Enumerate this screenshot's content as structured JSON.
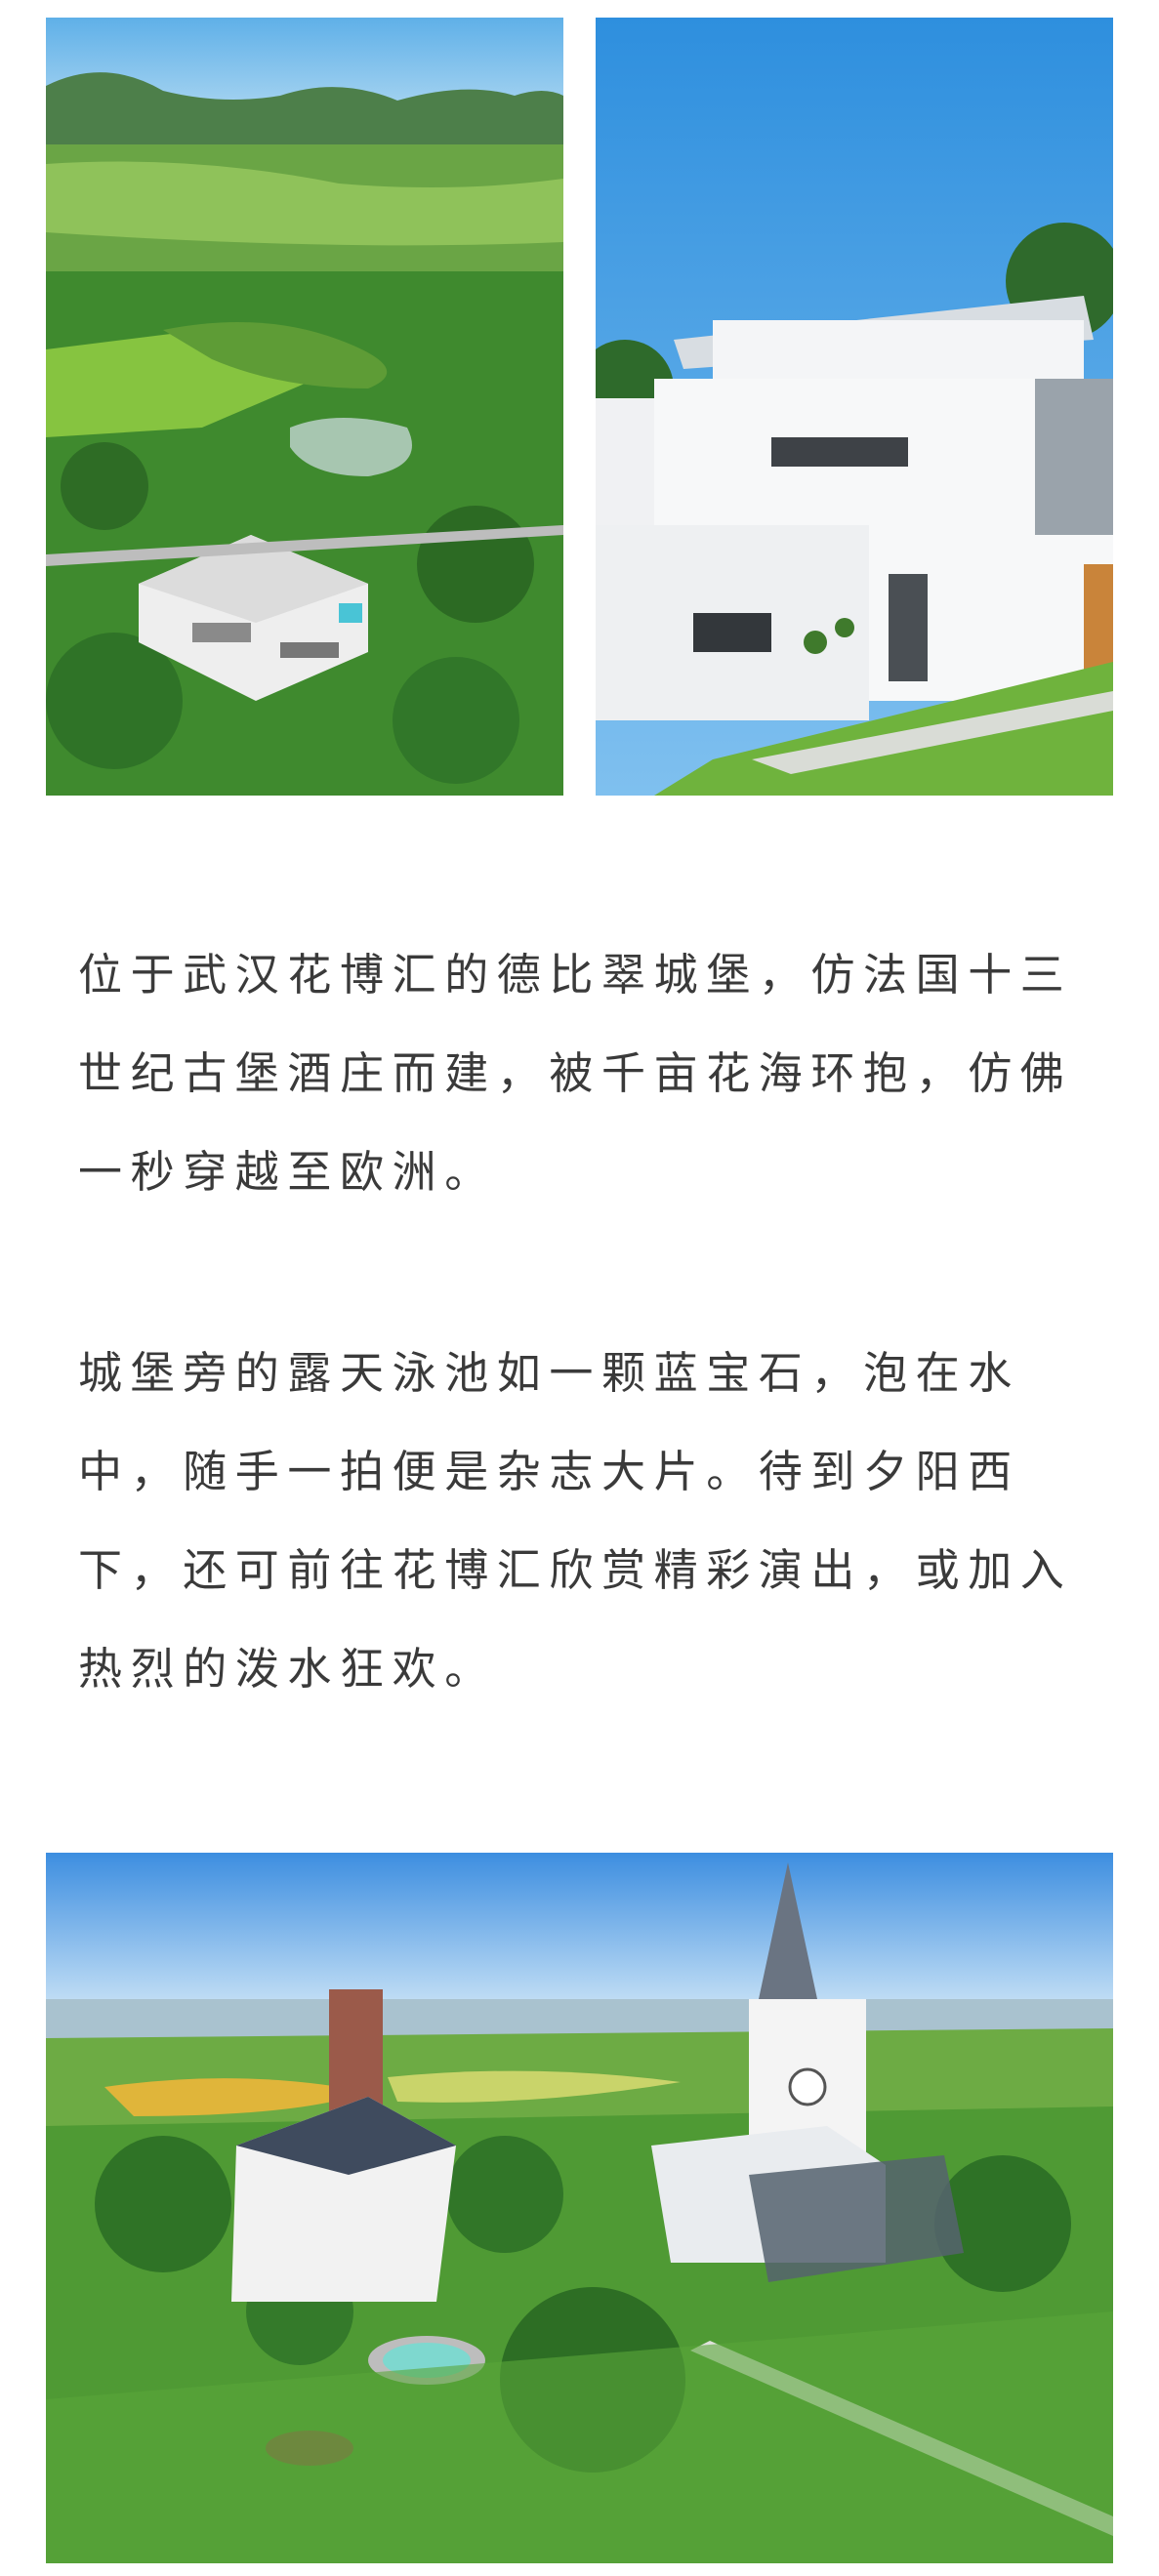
{
  "article": {
    "paragraphs": [
      "位于武汉花博汇的德比翠城堡，仿法国十三世纪古堡酒庄而建，被千亩花海环抱，仿佛一秒穿越至欧洲。",
      "城堡旁的露天泳池如一颗蓝宝石，泡在水中，随手一拍便是杂志大片。待到夕阳西下，还可前往花博汇欣赏精彩演出，或加入热烈的泼水狂欢。"
    ]
  },
  "colors": {
    "text": "#3a3a3a",
    "sky": "#3f9be0",
    "grass": "#6fb63a",
    "forest": "#2f7a2a",
    "building": "#f2f3f5"
  }
}
